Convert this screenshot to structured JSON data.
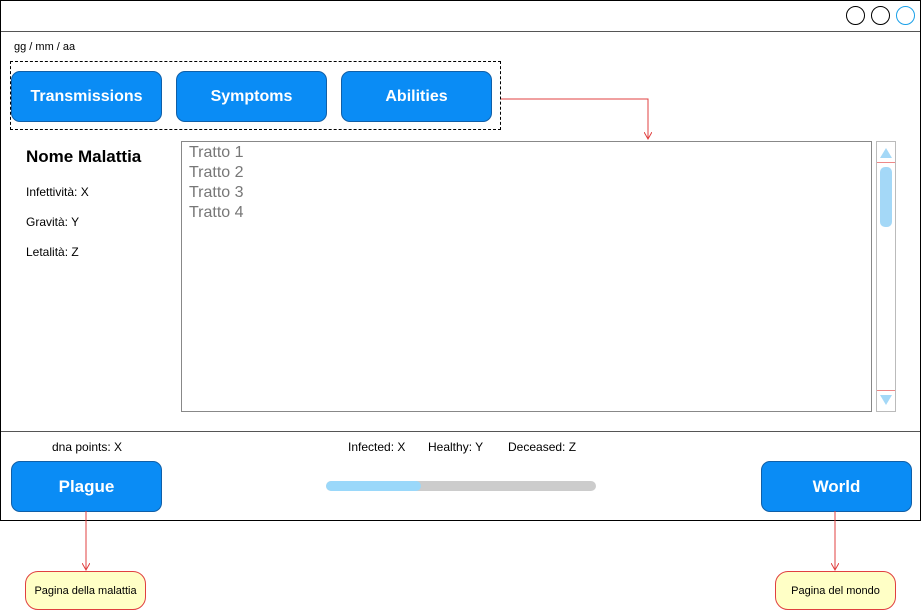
{
  "window": {
    "date": "gg / mm / aa"
  },
  "tabs": [
    {
      "label": "Transmissions"
    },
    {
      "label": "Symptoms"
    },
    {
      "label": "Abilities"
    }
  ],
  "disease": {
    "name": "Nome Malattia",
    "infectivity": "Infettività: X",
    "severity": "Gravità: Y",
    "lethality": "Letalità: Z"
  },
  "traits": [
    "Tratto 1",
    "Tratto 2",
    "Tratto 3",
    "Tratto 4"
  ],
  "footer": {
    "dna_points": "dna points: X",
    "infected": "Infected: X",
    "healthy": "Healthy: Y",
    "deceased": "Deceased: Z",
    "progress_fraction": 0.35,
    "plague_button": "Plague",
    "world_button": "World"
  },
  "notes": {
    "plague_page": "Pagina della malattia",
    "world_page": "Pagina del mondo"
  },
  "colors": {
    "button": "#0a8cf5",
    "arrow": "#e04040",
    "note_bg": "#ffffc6",
    "progress_fill": "#9ad8fa"
  }
}
